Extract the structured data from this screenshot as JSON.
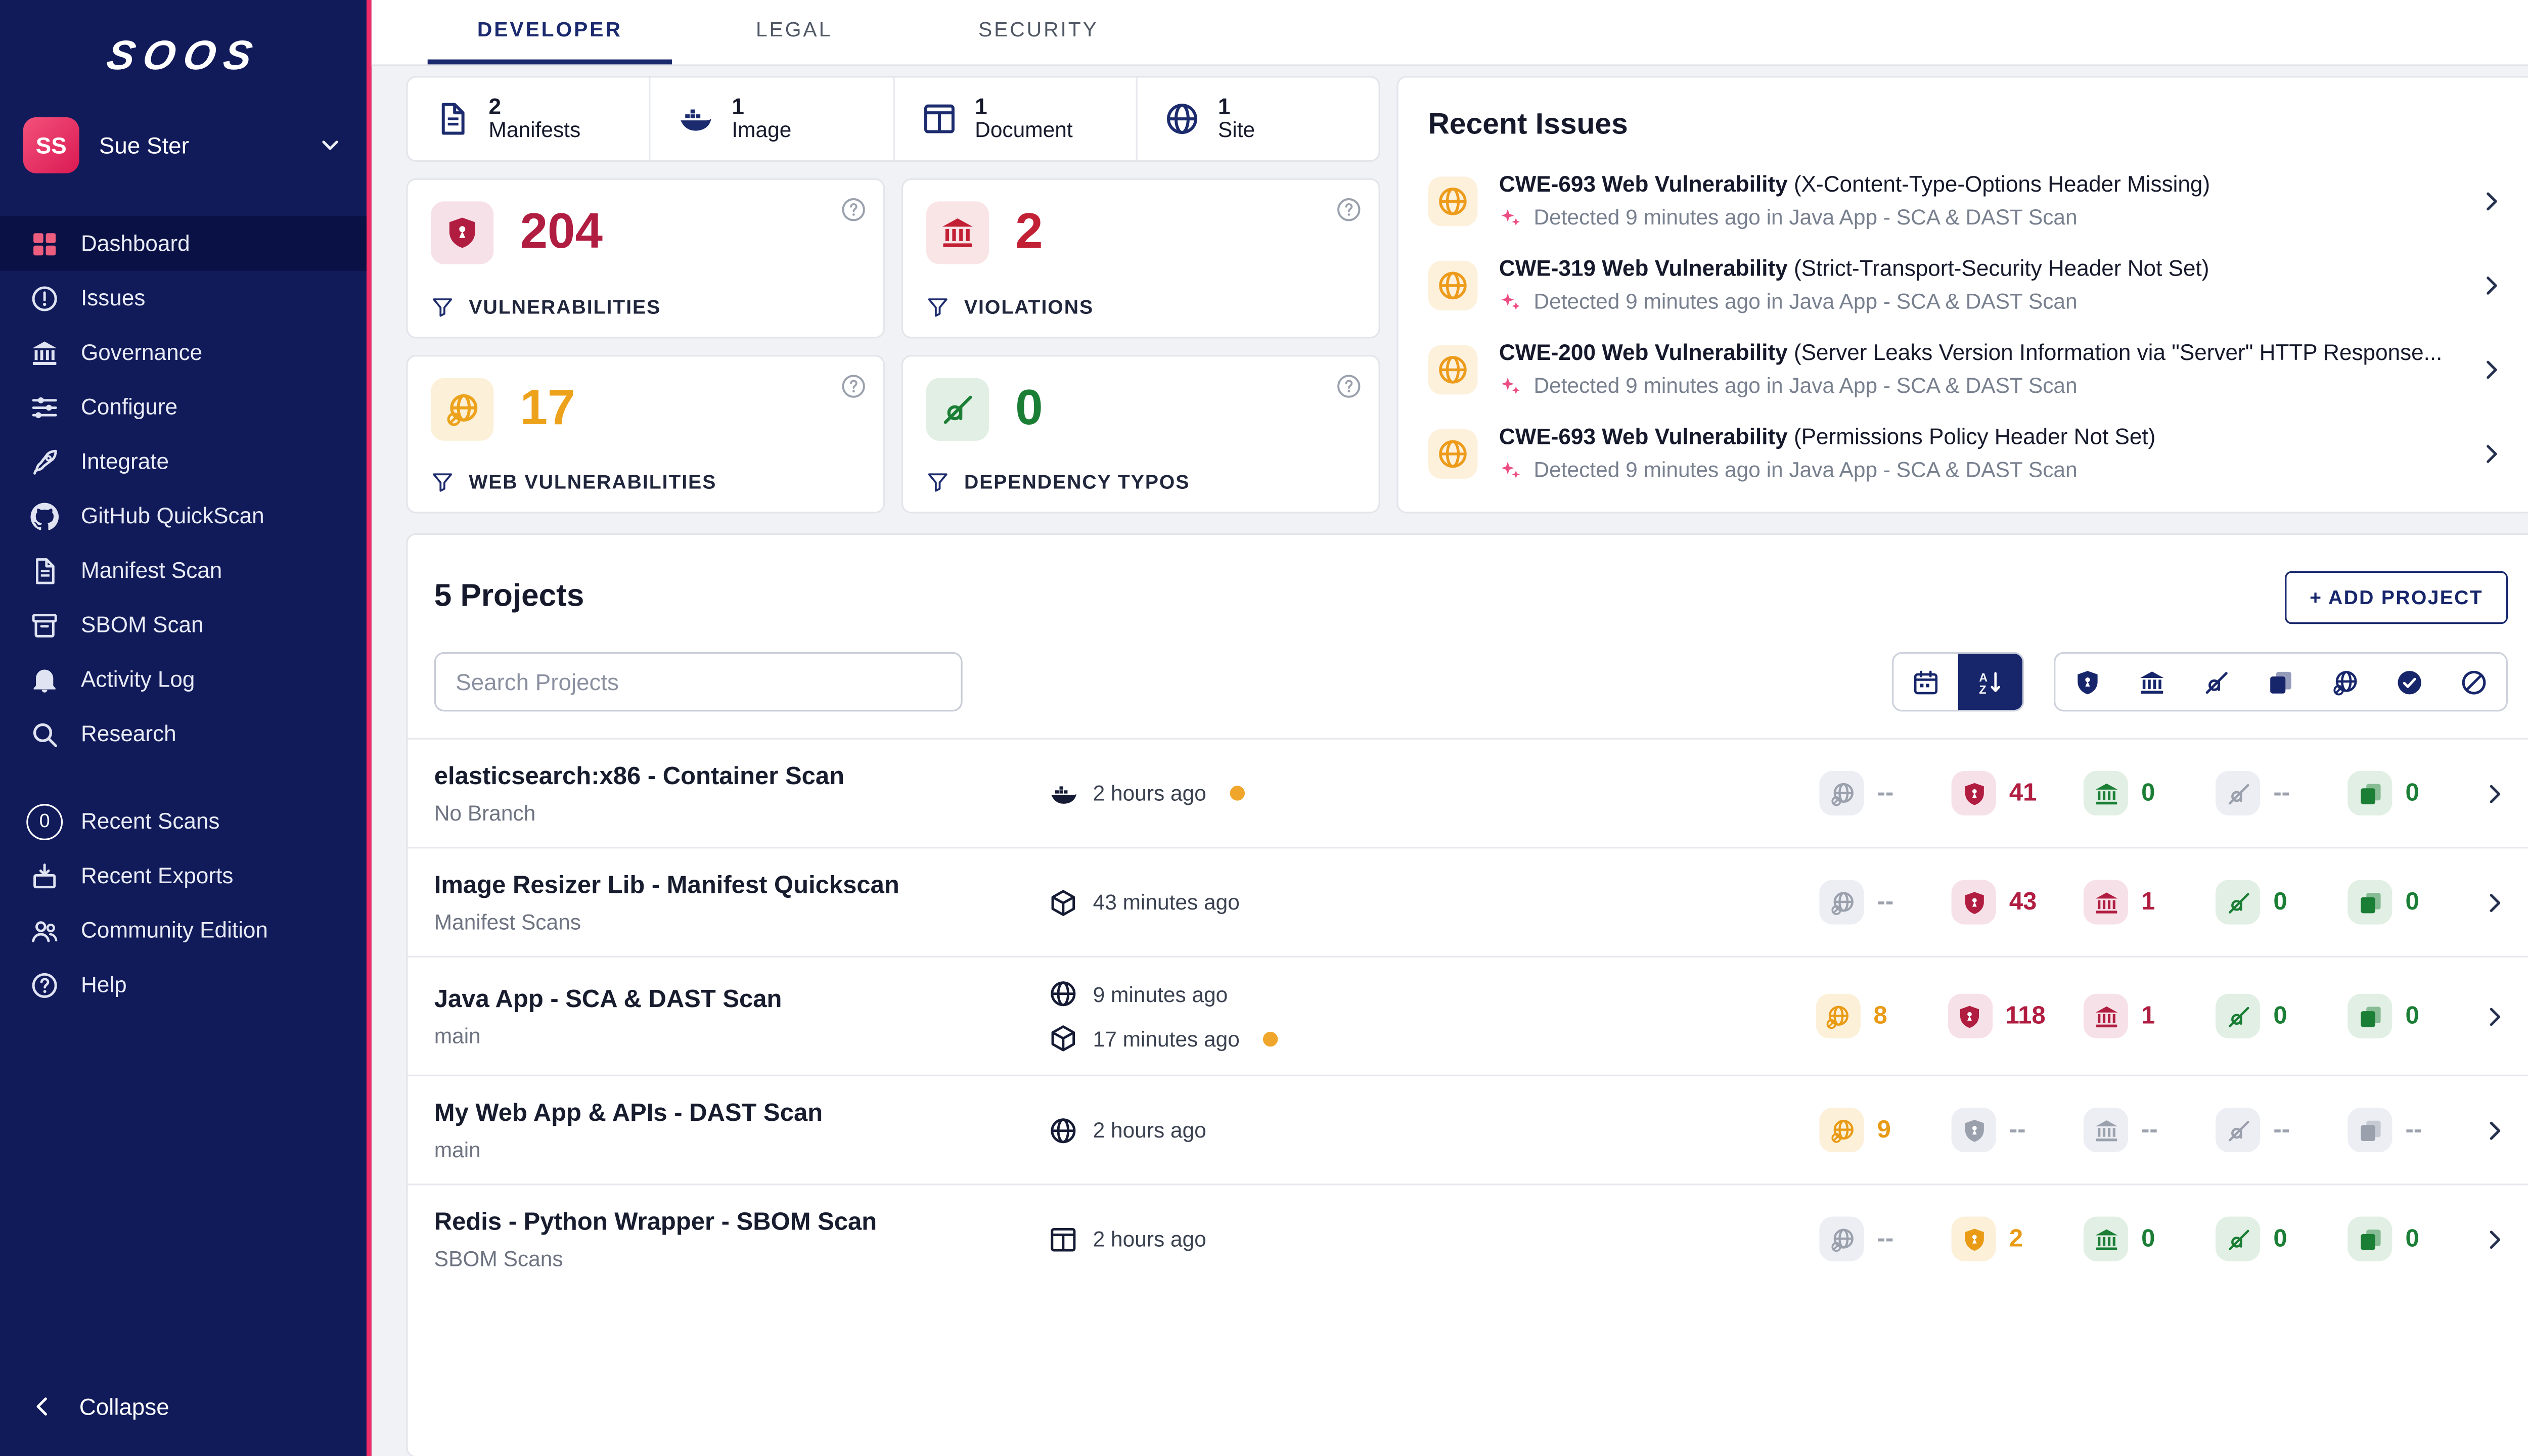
{
  "colors": {
    "brand_navy": "#111b5a",
    "brand_pink": "#ee2d68",
    "critical": "#b01d40",
    "warning": "#eda21b",
    "success": "#1b7e35",
    "muted": "#9aa0ac"
  },
  "brand": {
    "logo_text": "SOOS"
  },
  "user": {
    "initials": "SS",
    "name": "Sue Ster"
  },
  "sidebar": {
    "items": [
      {
        "label": "Dashboard"
      },
      {
        "label": "Issues"
      },
      {
        "label": "Governance"
      },
      {
        "label": "Configure"
      },
      {
        "label": "Integrate"
      },
      {
        "label": "GitHub QuickScan"
      },
      {
        "label": "Manifest Scan"
      },
      {
        "label": "SBOM Scan"
      },
      {
        "label": "Activity Log"
      },
      {
        "label": "Research"
      },
      {
        "label": "Recent Scans",
        "badge": "0"
      },
      {
        "label": "Recent Exports"
      },
      {
        "label": "Community Edition"
      },
      {
        "label": "Help"
      }
    ],
    "collapse_label": "Collapse"
  },
  "tabs": [
    {
      "label": "DEVELOPER"
    },
    {
      "label": "LEGAL"
    },
    {
      "label": "SECURITY"
    }
  ],
  "summary": [
    {
      "count": "2",
      "label": "Manifests",
      "icon": "file-icon"
    },
    {
      "count": "1",
      "label": "Image",
      "icon": "docker-icon"
    },
    {
      "count": "1",
      "label": "Document",
      "icon": "kanban-icon"
    },
    {
      "count": "1",
      "label": "Site",
      "icon": "globe-icon"
    }
  ],
  "stat_cards": [
    {
      "value": "204",
      "label": "VULNERABILITIES",
      "icon": "shield-icon"
    },
    {
      "value": "2",
      "label": "VIOLATIONS",
      "icon": "bank-icon"
    },
    {
      "value": "17",
      "label": "WEB VULNERABILITIES",
      "icon": "globe-slash-icon"
    },
    {
      "value": "0",
      "label": "DEPENDENCY TYPOS",
      "icon": "typo-icon"
    }
  ],
  "recent_issues": {
    "title": "Recent Issues",
    "items": [
      {
        "name": "CWE-693 Web Vulnerability",
        "summary": "(X-Content-Type-Options Header Missing)",
        "detail": "Detected 9 minutes ago in Java App - SCA & DAST Scan"
      },
      {
        "name": "CWE-319 Web Vulnerability",
        "summary": "(Strict-Transport-Security Header Not Set)",
        "detail": "Detected 9 minutes ago in Java App - SCA & DAST Scan"
      },
      {
        "name": "CWE-200 Web Vulnerability",
        "summary": "(Server Leaks Version Information via \"Server\" HTTP Response...",
        "detail": "Detected 9 minutes ago in Java App - SCA & DAST Scan"
      },
      {
        "name": "CWE-693 Web Vulnerability",
        "summary": "(Permissions Policy Header Not Set)",
        "detail": "Detected 9 minutes ago in Java App - SCA & DAST Scan"
      }
    ]
  },
  "projects": {
    "heading": "5 Projects",
    "add_button_label": "+ ADD PROJECT",
    "search_placeholder": "Search Projects",
    "rows": [
      {
        "name": "elasticsearch:x86 - Container Scan",
        "branch": "No Branch",
        "scans": [
          {
            "icon": "docker-icon",
            "time": "2 hours ago",
            "pending": true
          }
        ],
        "stats": [
          {
            "value": "--",
            "state": "muted"
          },
          {
            "value": "41",
            "state": "critical"
          },
          {
            "value": "0",
            "state": "good"
          },
          {
            "value": "--",
            "state": "muted"
          },
          {
            "value": "0",
            "state": "good"
          }
        ]
      },
      {
        "name": "Image Resizer Lib - Manifest Quickscan",
        "branch": "Manifest Scans",
        "scans": [
          {
            "icon": "package-icon",
            "time": "43 minutes ago",
            "pending": false
          }
        ],
        "stats": [
          {
            "value": "--",
            "state": "muted"
          },
          {
            "value": "43",
            "state": "critical"
          },
          {
            "value": "1",
            "state": "critical"
          },
          {
            "value": "0",
            "state": "good"
          },
          {
            "value": "0",
            "state": "good"
          }
        ]
      },
      {
        "name": "Java App - SCA & DAST Scan",
        "branch": "main",
        "scans": [
          {
            "icon": "globe-icon",
            "time": "9 minutes ago",
            "pending": false
          },
          {
            "icon": "package-icon",
            "time": "17 minutes ago",
            "pending": true
          }
        ],
        "stats": [
          {
            "value": "8",
            "state": "warn"
          },
          {
            "value": "118",
            "state": "critical"
          },
          {
            "value": "1",
            "state": "critical"
          },
          {
            "value": "0",
            "state": "good"
          },
          {
            "value": "0",
            "state": "good"
          }
        ]
      },
      {
        "name": "My Web App & APIs - DAST Scan",
        "branch": "main",
        "scans": [
          {
            "icon": "globe-icon",
            "time": "2 hours ago",
            "pending": false
          }
        ],
        "stats": [
          {
            "value": "9",
            "state": "warn"
          },
          {
            "value": "--",
            "state": "muted"
          },
          {
            "value": "--",
            "state": "muted"
          },
          {
            "value": "--",
            "state": "muted"
          },
          {
            "value": "--",
            "state": "muted"
          }
        ]
      },
      {
        "name": "Redis - Python Wrapper - SBOM Scan",
        "branch": "SBOM Scans",
        "scans": [
          {
            "icon": "kanban-icon",
            "time": "2 hours ago",
            "pending": false
          }
        ],
        "stats": [
          {
            "value": "--",
            "state": "muted"
          },
          {
            "value": "2",
            "state": "warn"
          },
          {
            "value": "0",
            "state": "good"
          },
          {
            "value": "0",
            "state": "good"
          },
          {
            "value": "0",
            "state": "good"
          }
        ]
      }
    ]
  }
}
